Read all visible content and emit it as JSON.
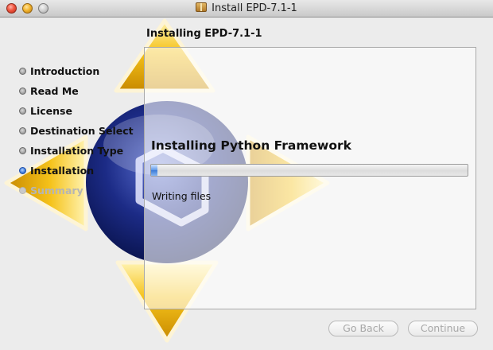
{
  "window": {
    "title": "Install EPD-7.1-1",
    "title_icon": "package-icon",
    "controls": [
      "close",
      "minimize",
      "zoom"
    ]
  },
  "heading": "Installing EPD-7.1-1",
  "steps": [
    {
      "label": "Introduction",
      "state": "done"
    },
    {
      "label": "Read Me",
      "state": "done"
    },
    {
      "label": "License",
      "state": "done"
    },
    {
      "label": "Destination Select",
      "state": "done"
    },
    {
      "label": "Installation Type",
      "state": "done"
    },
    {
      "label": "Installation",
      "state": "current"
    },
    {
      "label": "Summary",
      "state": "future"
    }
  ],
  "content": {
    "status_title": "Installing Python Framework",
    "progress": 0.02,
    "status_detail": "Writing files"
  },
  "buttons": {
    "back": "Go Back",
    "continue": "Continue"
  },
  "colors": {
    "accent": "#3c7ad6",
    "arrow_gold": "#f2b900",
    "orb_blue": "#1a2a7a"
  }
}
